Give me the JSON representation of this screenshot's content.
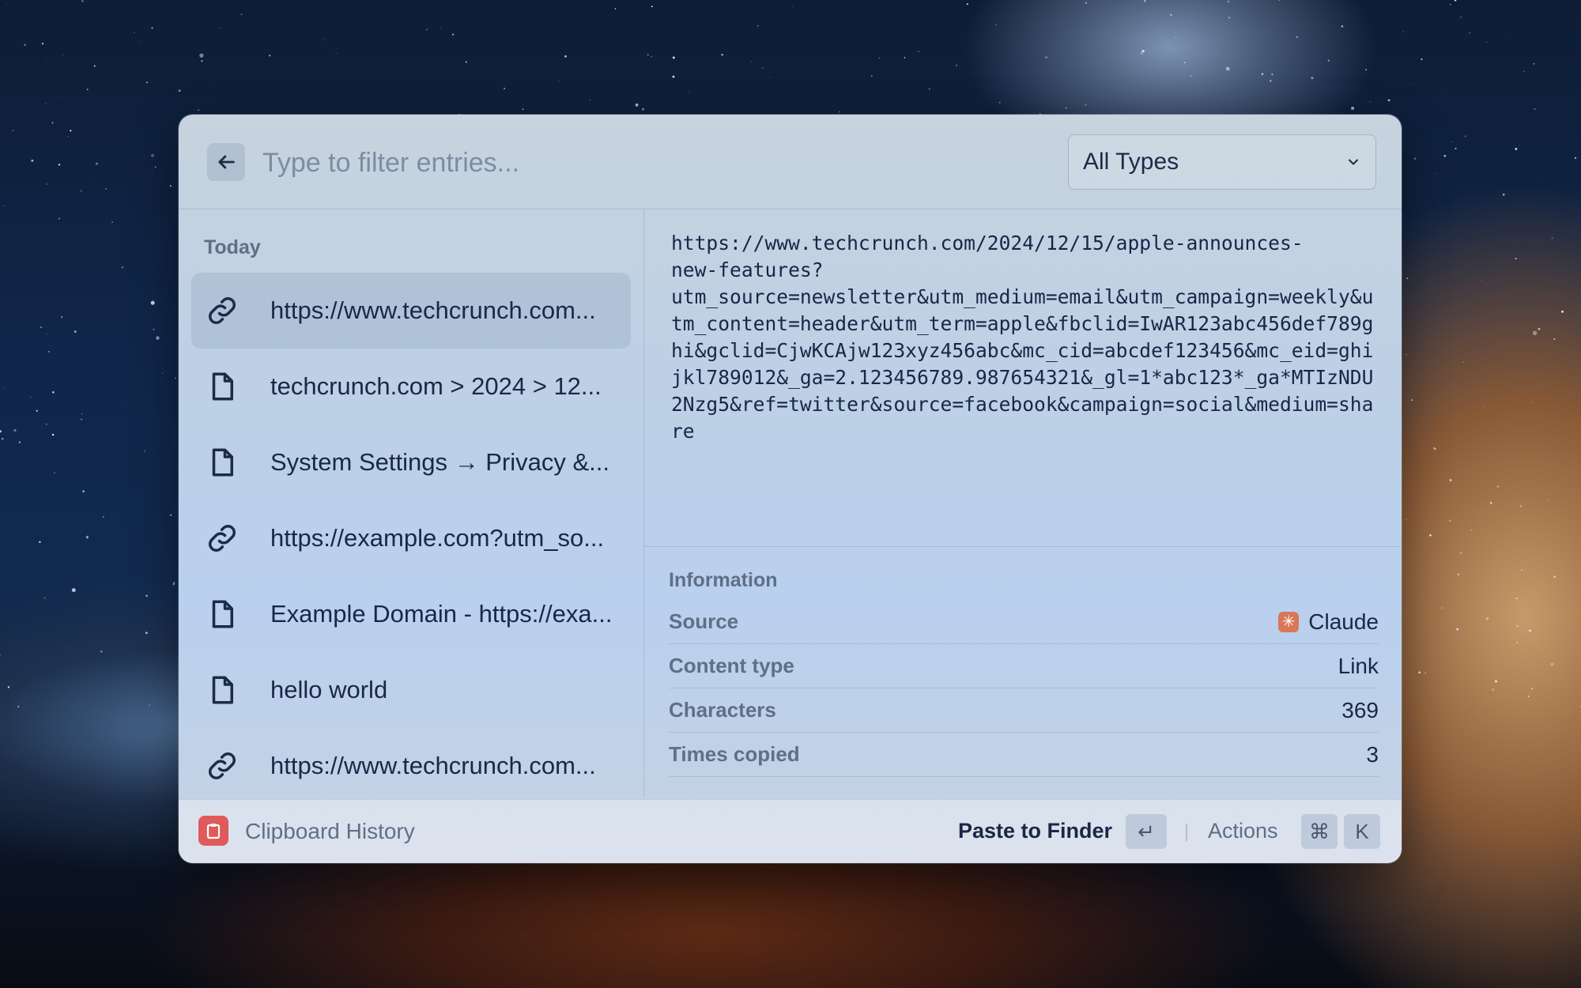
{
  "search": {
    "placeholder": "Type to filter entries...",
    "value": ""
  },
  "type_filter": {
    "selected": "All Types"
  },
  "sidebar": {
    "section_title": "Today",
    "items": [
      {
        "icon": "link-icon",
        "label": "https://www.techcrunch.com...",
        "selected": true
      },
      {
        "icon": "file-icon",
        "label": "techcrunch.com > 2024 > 12...",
        "selected": false
      },
      {
        "icon": "file-icon",
        "label": "System Settings → Privacy &...",
        "selected": false
      },
      {
        "icon": "link-icon",
        "label": "https://example.com?utm_so...",
        "selected": false
      },
      {
        "icon": "file-icon",
        "label": "Example Domain - https://exa...",
        "selected": false
      },
      {
        "icon": "file-icon",
        "label": "hello world",
        "selected": false
      },
      {
        "icon": "link-icon",
        "label": "https://www.techcrunch.com...",
        "selected": false
      }
    ]
  },
  "detail": {
    "content": "https://www.techcrunch.com/2024/12/15/apple-announces-\nnew-features?\nutm_source=newsletter&utm_medium=email&utm_campaign=weekly&utm_content=header&utm_term=apple&fbclid=IwAR123abc456def789ghi&gclid=CjwKCAjw123xyz456abc&mc_cid=abcdef123456&mc_eid=ghijkl789012&_ga=2.123456789.987654321&_gl=1*abc123*_ga*MTIzNDU2Nzg5&ref=twitter&source=facebook&campaign=social&medium=share",
    "info_title": "Information",
    "info": [
      {
        "key": "Source",
        "value": "Claude"
      },
      {
        "key": "Content type",
        "value": "Link"
      },
      {
        "key": "Characters",
        "value": "369"
      },
      {
        "key": "Times copied",
        "value": "3"
      }
    ]
  },
  "footer": {
    "app_name": "Clipboard History",
    "primary_action": "Paste to Finder",
    "enter_key": "↵",
    "actions_label": "Actions",
    "cmd_key": "⌘",
    "k_key": "K"
  },
  "colors": {
    "app_icon": "#e05a5a",
    "claude_icon": "#d97757",
    "text": "#1b2748",
    "muted": "#5f6f88"
  }
}
